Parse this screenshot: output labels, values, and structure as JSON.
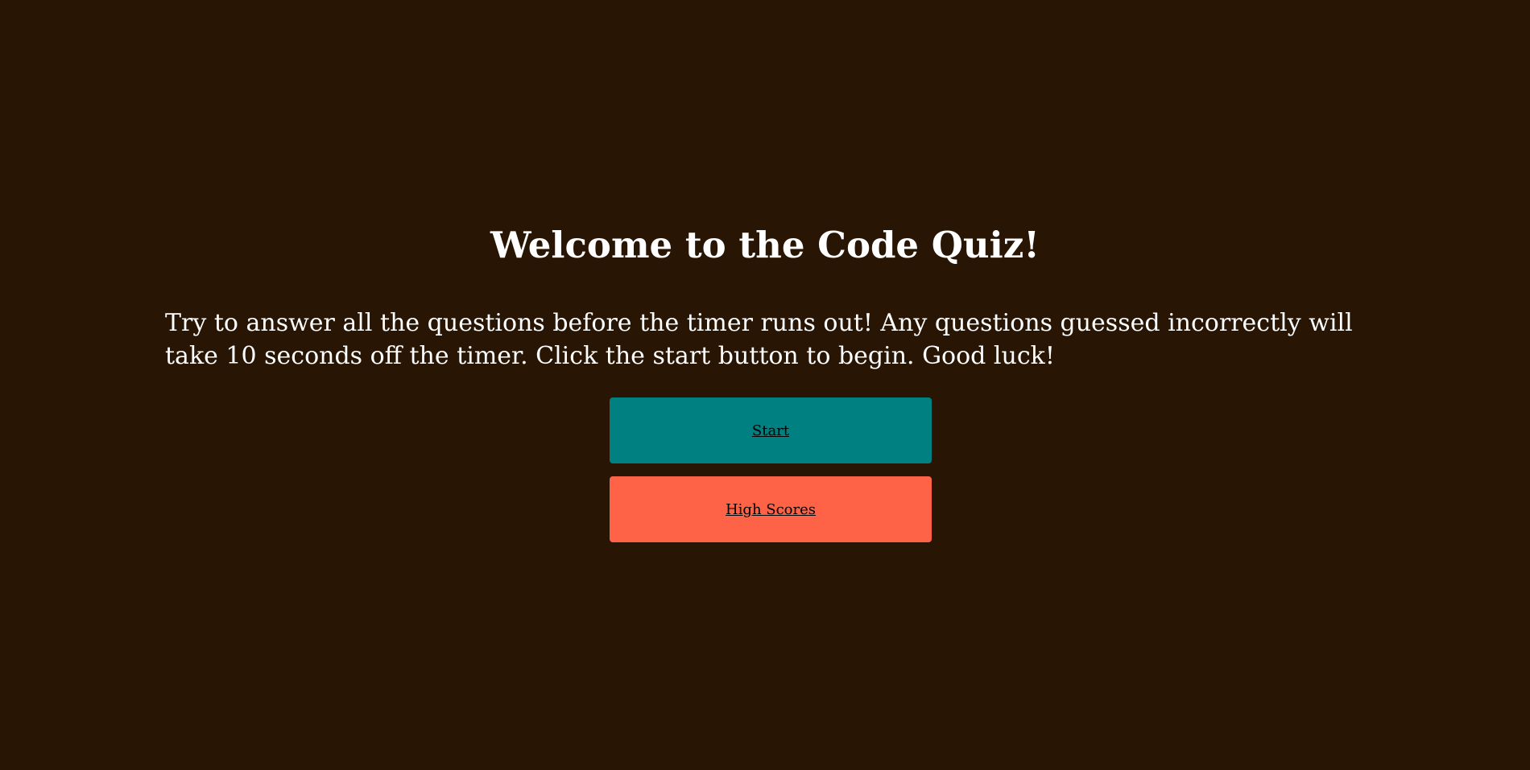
{
  "page": {
    "title": "Welcome to the Code Quiz!",
    "intro": "Try to answer all the questions before the timer runs out! Any questions guessed incorrectly will take 10 seconds off the timer. Click the start button to begin. Good luck!",
    "buttons": {
      "start_label": "Start",
      "high_scores_label": "High Scores"
    }
  },
  "colors": {
    "background": "#281503",
    "text": "#ffffff",
    "start_button": "#008080",
    "high_scores_button": "#ff6347",
    "button_text": "#000000"
  }
}
